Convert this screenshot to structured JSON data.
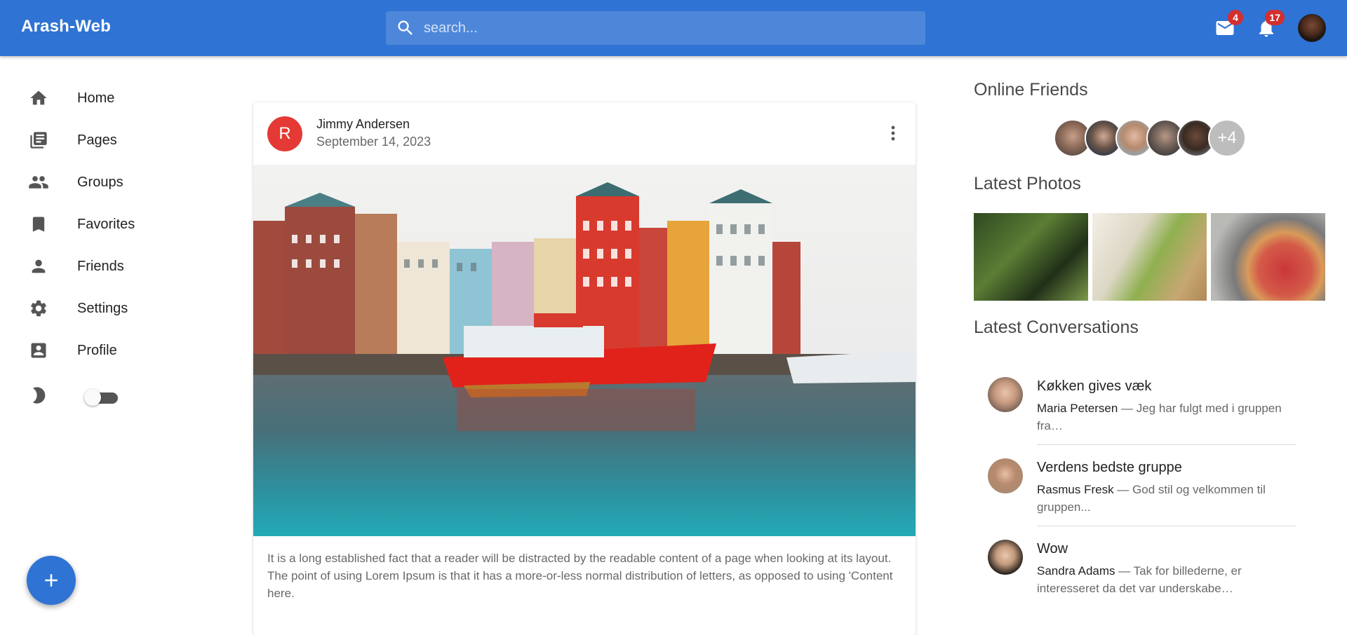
{
  "appbar": {
    "brand": "Arash-Web",
    "search_placeholder": "search...",
    "mail_count": "4",
    "notifications_count": "17"
  },
  "sidebar": {
    "items": [
      {
        "label": "Home",
        "icon": "home-icon"
      },
      {
        "label": "Pages",
        "icon": "pages-icon"
      },
      {
        "label": "Groups",
        "icon": "groups-icon"
      },
      {
        "label": "Favorites",
        "icon": "bookmark-icon"
      },
      {
        "label": "Friends",
        "icon": "person-icon"
      },
      {
        "label": "Settings",
        "icon": "gear-icon"
      },
      {
        "label": "Profile",
        "icon": "profile-icon"
      }
    ],
    "dark_mode_enabled": false
  },
  "post": {
    "avatar_letter": "R",
    "author": "Jimmy Andersen",
    "date": "September 14, 2023",
    "text": "It is a long established fact that a reader will be distracted by the readable content of a page when looking at its layout. The point of using Lorem Ipsum is that it has a more-or-less normal distribution of letters, as opposed to using 'Content here."
  },
  "right": {
    "online_title": "Online Friends",
    "online_more": "+4",
    "photos_title": "Latest Photos",
    "conversations_title": "Latest Conversations",
    "conversations": [
      {
        "title": "Køkken gives væk",
        "sender": "Maria Petersen",
        "snippet": " — Jeg har fulgt med i gruppen fra…"
      },
      {
        "title": "Verdens bedste gruppe",
        "sender": "Rasmus Fresk",
        "snippet": " — God stil og velkommen til gruppen..."
      },
      {
        "title": "Wow",
        "sender": "Sandra Adams",
        "snippet": " — Tak for billederne, er interesseret da det var underskabe…"
      }
    ]
  },
  "colors": {
    "appbar": "#2f73d4",
    "badge": "#d32f2f",
    "post_avatar": "#e53935"
  }
}
